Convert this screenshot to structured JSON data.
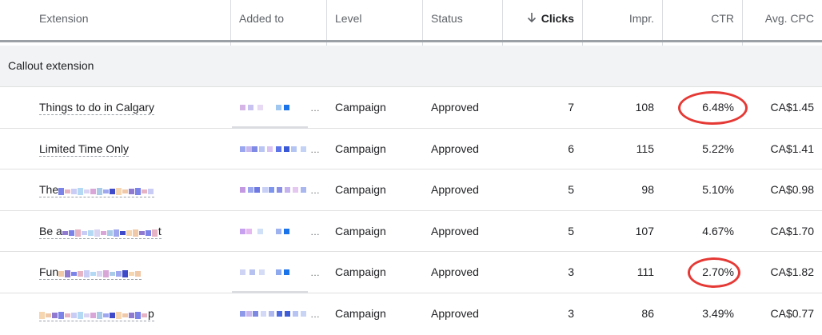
{
  "columns": {
    "extension": "Extension",
    "added_to": "Added to",
    "level": "Level",
    "status": "Status",
    "clicks": "Clicks",
    "impr": "Impr.",
    "ctr": "CTR",
    "avg_cpc": "Avg. CPC"
  },
  "sort": {
    "column": "clicks",
    "direction": "descending",
    "icon": "arrow-down-icon"
  },
  "group": {
    "label": "Callout extension"
  },
  "rows": [
    {
      "extension": "Things to do in Calgary",
      "level": "Campaign",
      "status": "Approved",
      "clicks": "7",
      "impr": "108",
      "ctr": "6.48%",
      "avg_cpc": "CA$1.45",
      "circled": true
    },
    {
      "extension": "Limited Time Only",
      "level": "Campaign",
      "status": "Approved",
      "clicks": "6",
      "impr": "115",
      "ctr": "5.22%",
      "avg_cpc": "CA$1.41",
      "circled": false
    },
    {
      "extension": "The",
      "level": "Campaign",
      "status": "Approved",
      "clicks": "5",
      "impr": "98",
      "ctr": "5.10%",
      "avg_cpc": "CA$0.98",
      "circled": false
    },
    {
      "extension": "Be a",
      "extension_suffix": "t",
      "level": "Campaign",
      "status": "Approved",
      "clicks": "5",
      "impr": "107",
      "ctr": "4.67%",
      "avg_cpc": "CA$1.70",
      "circled": false
    },
    {
      "extension": "Fun",
      "level": "Campaign",
      "status": "Approved",
      "clicks": "3",
      "impr": "111",
      "ctr": "2.70%",
      "avg_cpc": "CA$1.82",
      "circled": true
    },
    {
      "extension": "",
      "extension_suffix": "p",
      "level": "Campaign",
      "status": "Approved",
      "clicks": "3",
      "impr": "86",
      "ctr": "3.49%",
      "avg_cpc": "CA$0.77",
      "circled": false
    }
  ],
  "colors": {
    "highlight_circle": "#e53935",
    "header_rule": "#9aa0a6",
    "group_bg": "#f1f3f4"
  }
}
